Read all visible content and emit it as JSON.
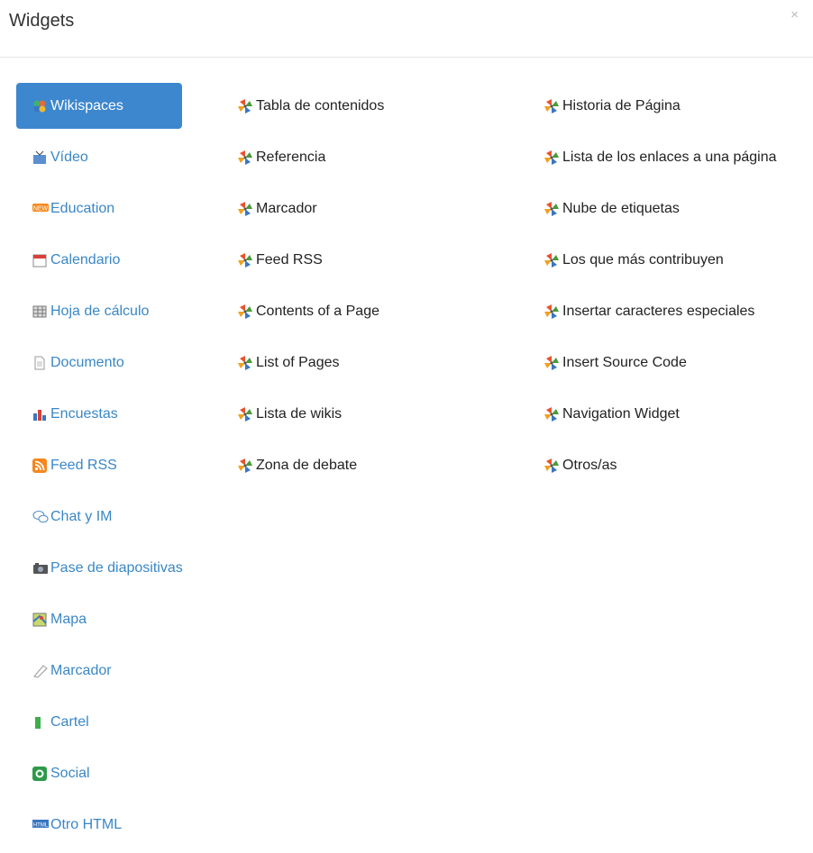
{
  "dialog": {
    "title": "Widgets",
    "close_glyph": "×"
  },
  "categories": [
    {
      "label": "Wikispaces",
      "icon": "wikispaces-icon",
      "active": true
    },
    {
      "label": "Vídeo",
      "icon": "video-icon"
    },
    {
      "label": "Education",
      "icon": "new-badge-icon"
    },
    {
      "label": "Calendario",
      "icon": "calendar-icon"
    },
    {
      "label": "Hoja de cálculo",
      "icon": "spreadsheet-icon"
    },
    {
      "label": "Documento",
      "icon": "document-icon"
    },
    {
      "label": "Encuestas",
      "icon": "bar-chart-icon"
    },
    {
      "label": "Feed RSS",
      "icon": "rss-icon"
    },
    {
      "label": "Chat y IM",
      "icon": "chat-icon"
    },
    {
      "label": "Pase de diapositivas",
      "icon": "camera-icon"
    },
    {
      "label": "Mapa",
      "icon": "map-icon"
    },
    {
      "label": "Marcador",
      "icon": "bookmark-icon"
    },
    {
      "label": "Cartel",
      "icon": "banner-icon"
    },
    {
      "label": "Social",
      "icon": "social-icon"
    },
    {
      "label": "Otro HTML",
      "icon": "html-icon"
    }
  ],
  "widgets_col1": [
    "Tabla de contenidos",
    "Referencia",
    "Marcador",
    "Feed RSS",
    "Contents of a Page",
    "List of Pages",
    "Lista de wikis",
    "Zona de debate"
  ],
  "widgets_col2": [
    "Historia de Página",
    "Lista de los enlaces a una página",
    "Nube de etiquetas",
    "Los que más contribuyen",
    "Insertar caracteres especiales",
    "Insert Source Code",
    "Navigation Widget",
    "Otros/as"
  ],
  "colors": {
    "accent": "#3d87cf",
    "link": "#3a87c6",
    "text": "#222222"
  }
}
